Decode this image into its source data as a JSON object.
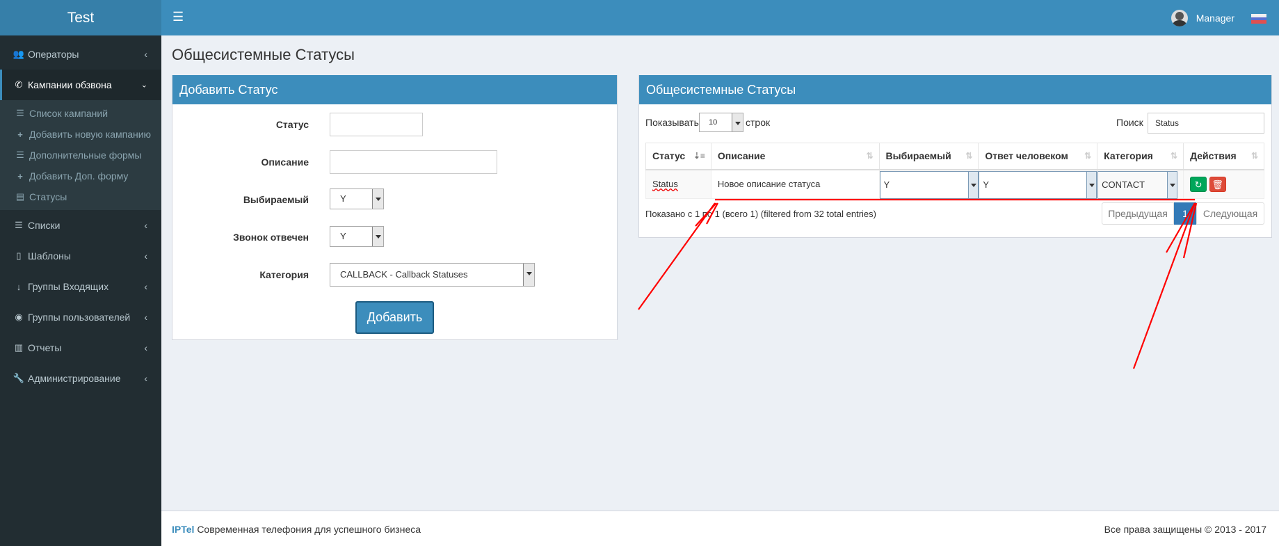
{
  "app": {
    "logo": "Test"
  },
  "header": {
    "user_name": "Manager"
  },
  "sidebar": {
    "items": [
      {
        "label": "Операторы",
        "icon": "users-icon"
      },
      {
        "label": "Кампании обзвона",
        "icon": "phone-icon"
      },
      {
        "label": "Списки",
        "icon": "list-icon"
      },
      {
        "label": "Шаблоны",
        "icon": "code-file-icon"
      },
      {
        "label": "Группы Входящих",
        "icon": "arrow-down-icon"
      },
      {
        "label": "Группы пользователей",
        "icon": "user-circle-icon"
      },
      {
        "label": "Отчеты",
        "icon": "bar-chart-icon"
      },
      {
        "label": "Администрирование",
        "icon": "wrench-icon"
      }
    ],
    "subitems": [
      {
        "label": "Список кампаний",
        "icon": "list-icon"
      },
      {
        "label": "Добавить новую кампанию",
        "icon": "plus-icon"
      },
      {
        "label": "Дополнительные формы",
        "icon": "list-icon"
      },
      {
        "label": "Добавить Доп. форму",
        "icon": "plus-icon"
      },
      {
        "label": "Статусы",
        "icon": "table-icon"
      }
    ]
  },
  "page": {
    "title": "Общесистемные Статусы"
  },
  "add_form": {
    "title": "Добавить Статус",
    "status_label": "Статус",
    "description_label": "Описание",
    "selectable_label": "Выбираемый",
    "selectable_value": "Y",
    "answered_label": "Звонок отвечен",
    "answered_value": "Y",
    "category_label": "Категория",
    "category_value": "CALLBACK - Callback Statuses",
    "submit_label": "Добавить"
  },
  "table_box": {
    "title": "Общесистемные Статусы",
    "show_label": "Показывать",
    "page_size": "10",
    "rows_label": "строк",
    "search_label": "Поиск",
    "search_value": "Status",
    "columns": [
      "Статус",
      "Описание",
      "Выбираемый",
      "Ответ человеком",
      "Категория",
      "Действия"
    ],
    "rows": [
      {
        "status": "Status",
        "description": "Новое описание статуса",
        "selectable": "Y",
        "human_answer": "Y",
        "category": "CONTACT"
      }
    ],
    "info": "Показано с 1 по 1 (всего 1) (filtered from 32 total entries)",
    "prev_label": "Предыдущая",
    "next_label": "Следующая",
    "current_page": "1"
  },
  "footer": {
    "brand": "IPTel",
    "tagline": "Современная телефония для успешного бизнеса",
    "copyright": "Все права защищены © 2013 - 2017"
  },
  "colors": {
    "accent": "#3c8dbc",
    "sidebar": "#222d32",
    "success": "#00a65a",
    "danger": "#dd4b39",
    "annotation": "#ff0000"
  }
}
